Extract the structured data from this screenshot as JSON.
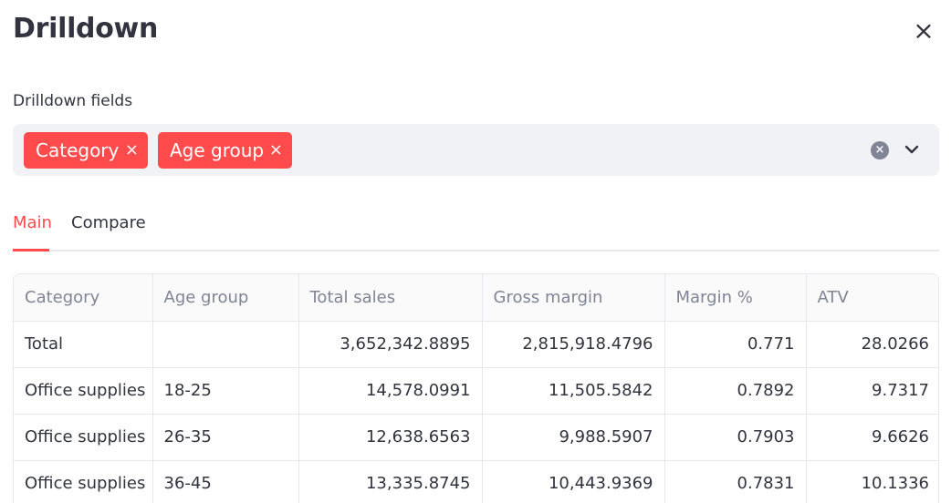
{
  "dialog": {
    "title": "Drilldown",
    "close_icon": "×"
  },
  "drilldown": {
    "label": "Drilldown fields",
    "selected": [
      {
        "label": "Category",
        "remove_icon": "×"
      },
      {
        "label": "Age group",
        "remove_icon": "×"
      }
    ],
    "clear_icon": "×"
  },
  "tabs": [
    {
      "label": "Main",
      "active": true
    },
    {
      "label": "Compare",
      "active": false
    }
  ],
  "accent_color": "#ff4b4b",
  "table": {
    "columns": [
      "Category",
      "Age group",
      "Total sales",
      "Gross margin",
      "Margin %",
      "ATV"
    ],
    "rows": [
      [
        "Total",
        "",
        "3,652,342.8895",
        "2,815,918.4796",
        "0.771",
        "28.0266"
      ],
      [
        "Office supplies",
        "18-25",
        "14,578.0991",
        "11,505.5842",
        "0.7892",
        "9.7317"
      ],
      [
        "Office supplies",
        "26-35",
        "12,638.6563",
        "9,988.5907",
        "0.7903",
        "9.6626"
      ],
      [
        "Office supplies",
        "36-45",
        "13,335.8745",
        "10,443.9369",
        "0.7831",
        "10.1336"
      ]
    ]
  }
}
